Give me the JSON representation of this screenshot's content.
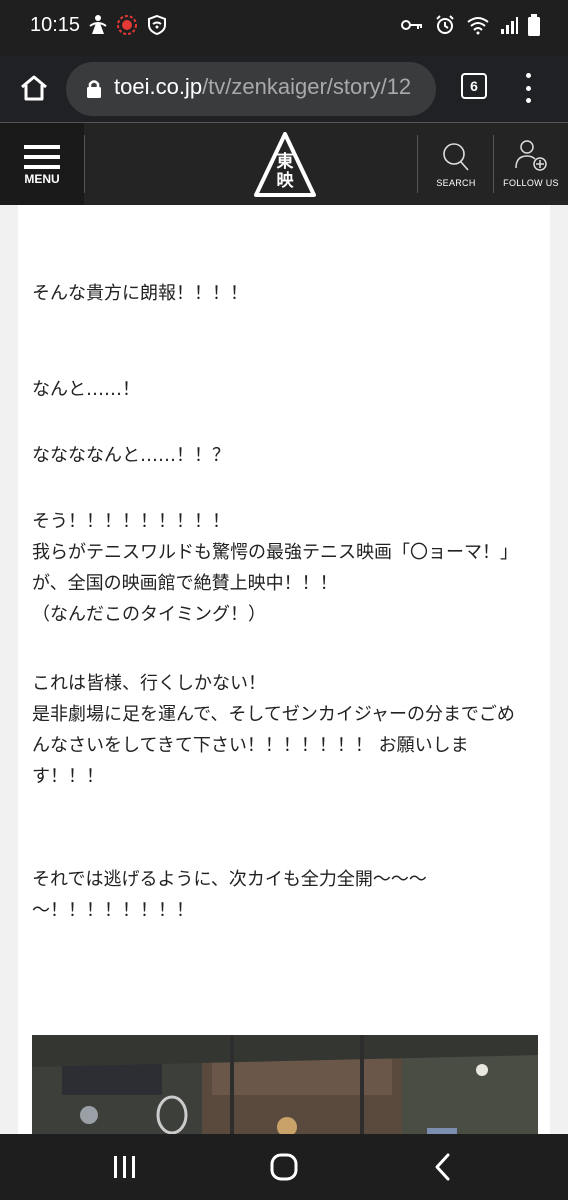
{
  "status_bar": {
    "time": "10:15",
    "left_icons": [
      "signal-person-icon",
      "recording-icon",
      "shield-wifi-icon"
    ],
    "right_icons": [
      "key-icon",
      "alarm-icon",
      "wifi-icon",
      "cell-signal-icon",
      "battery-icon"
    ]
  },
  "browser": {
    "url_domain": "toei.co.jp",
    "url_path": "/tv/zenkaiger/story/12",
    "tab_count": "6"
  },
  "site_header": {
    "menu_label": "MENU",
    "logo_text_top": "東",
    "logo_text_bottom": "映",
    "search_label": "SEARCH",
    "follow_label": "FOLLOW US"
  },
  "article": {
    "p1": "そんな貴方に朗報！！！！",
    "p2": "なんと……！",
    "p3": "ななななんと……！！？",
    "p4_lines": [
      "そう！！！！！！！！！",
      "我らがテニスワルドも驚愕の最強テニス映画「〇ョーマ！」",
      "が、全国の映画館で絶賛上映中！！！",
      "（なんだこのタイミング！）"
    ],
    "p5_lines": [
      "これは皆様、行くしかない！",
      "是非劇場に足を運んで、そしてゼンカイジャーの分までごめ",
      "んなさいをしてきて下さい！！！！！！！ お願いしま",
      "す！！！"
    ],
    "p6_lines": [
      "それでは逃げるように、次カイも全力全開〜〜〜",
      "〜！！！！！！！！"
    ]
  },
  "nav_bar": {
    "icons": [
      "recent-apps-icon",
      "home-icon",
      "back-icon"
    ]
  }
}
